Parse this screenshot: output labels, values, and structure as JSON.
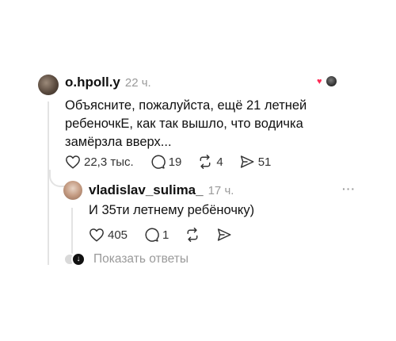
{
  "post": {
    "username": "o.hpoll.y",
    "time": "22 ч.",
    "text": "Объясните, пожалуйста, ещё 21 летней ребеночкЕ, как так вышло, что водичка замёрзла вверх...",
    "likes": "22,3 тыс.",
    "comments": "19",
    "reposts": "4",
    "shares": "51"
  },
  "reply": {
    "username": "vladislav_sulima_",
    "time": "17 ч.",
    "text": "И 35ти летнему ребёночку)",
    "likes": "405",
    "comments": "1",
    "more": "···"
  },
  "show_replies": {
    "label": "Показать ответы"
  },
  "colors": {
    "heart": "#ff2b55",
    "muted": "#9a9a9a",
    "line": "#e3e3e3"
  },
  "icons": [
    "heart-icon",
    "comment-icon",
    "repost-icon",
    "share-icon",
    "more-icon"
  ]
}
